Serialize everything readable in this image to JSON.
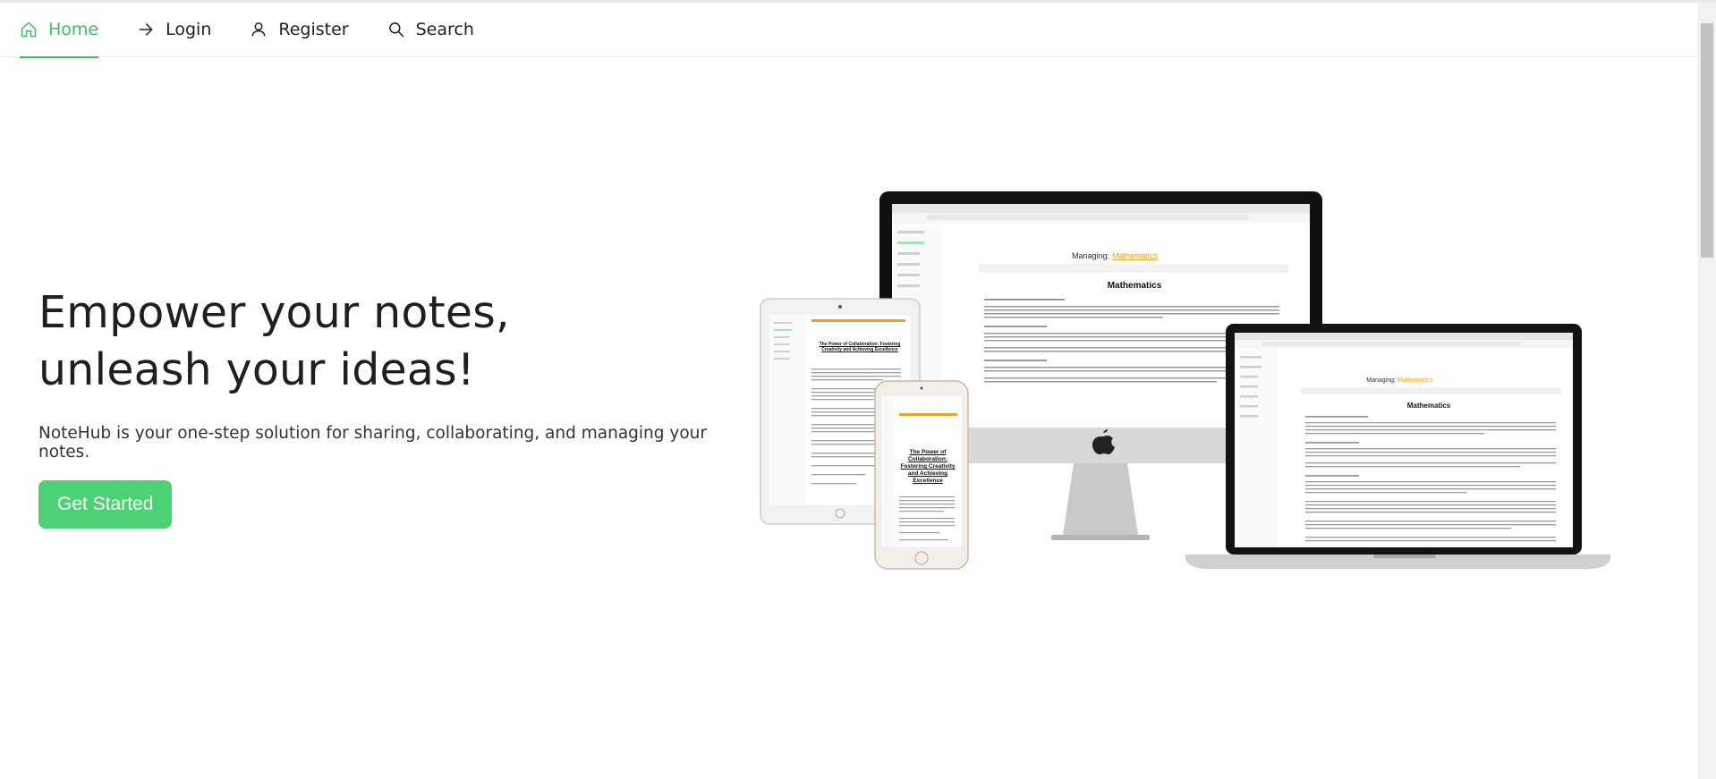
{
  "nav": {
    "items": [
      {
        "label": "Home",
        "icon": "home-icon",
        "active": true
      },
      {
        "label": "Login",
        "icon": "arrow-right-icon",
        "active": false
      },
      {
        "label": "Register",
        "icon": "user-icon",
        "active": false
      },
      {
        "label": "Search",
        "icon": "search-icon",
        "active": false
      }
    ]
  },
  "hero": {
    "headline_line1": "Empower your notes,",
    "headline_line2": "unleash your ideas!",
    "subtitle": "NoteHub is your one-step solution for sharing, collaborating, and managing your notes.",
    "cta_label": "Get Started"
  },
  "mockup": {
    "desktop_heading_prefix": "Managing:",
    "desktop_heading_subject": "Mathematics",
    "desktop_doc_title": "Mathematics",
    "tablet_doc_title": "The Power of Collaboration: Fostering Creativity and Achieving Excellence",
    "phone_doc_title": "The Power of Collaboration: Fostering Creativity and Achieving Excellence"
  },
  "colors": {
    "accent": "#3ebd61",
    "cta": "#4cd175",
    "link_orange": "#f0a020"
  }
}
